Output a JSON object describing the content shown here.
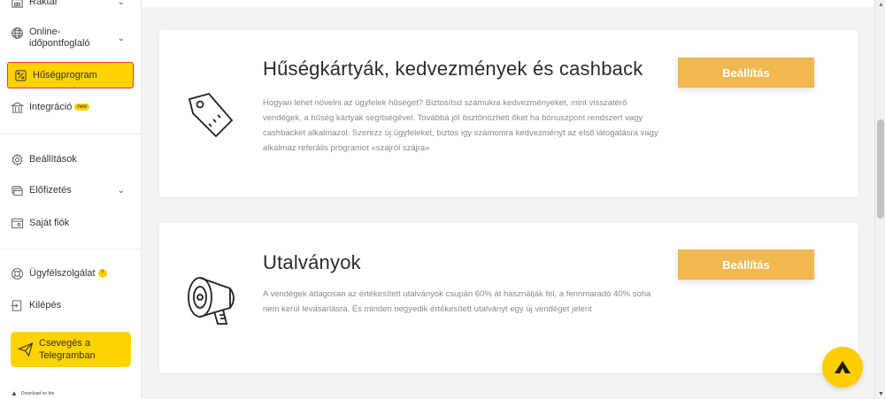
{
  "sidebar": {
    "items": [
      {
        "label": "Raktár",
        "icon": "warehouse-icon"
      },
      {
        "label": "Online-időpontfoglaló",
        "line1": "Online-",
        "line2": "időpontfoglaló",
        "icon": "globe-icon"
      },
      {
        "label": "Hűségprogram",
        "icon": "loyalty-icon"
      },
      {
        "label": "Integráció",
        "badge": "new",
        "icon": "integration-icon"
      },
      {
        "label": "Beállítások",
        "icon": "gear-icon"
      },
      {
        "label": "Előfizetés",
        "icon": "subscription-icon"
      },
      {
        "label": "Saját fiók",
        "icon": "account-icon"
      },
      {
        "label": "Ügyfélszolgálat",
        "badge": "?",
        "icon": "support-icon"
      },
      {
        "label": "Kilépés",
        "icon": "logout-icon"
      }
    ],
    "telegram": {
      "line1": "Csevegés a",
      "line2": "Telegramban"
    },
    "appstore": "Download on the"
  },
  "cards": [
    {
      "title": "Hűségkártyák, kedvezmények és cashback",
      "description": "Hogyan lehet növelni az ügyfelek hűségét? Biztosítsd számukra kedvezményeket, mint visszatérő vendégek, a hűség kártyák segítségével. Továbbá jól ösztönözheti őket ha bónuszpont rendszert vagy cashbacket alkalmazol. Szerezz új ügyfeleket, biztos igy számomra kedvezményt az első látogatásra vagy alkalmaz referális programot «szájról szájra»",
      "button": "Beállítás",
      "icon": "price-tag-icon"
    },
    {
      "title": "Utalványok",
      "description": "A vendégek átlagosan az értékesített utalványok csupán 60% át használják fel, a fennmaradó 40% soha nem kerül levásárlásra. És minden negyedik értékesített utalványt egy új vendéget jelent",
      "button": "Beállítás",
      "icon": "megaphone-icon"
    }
  ],
  "colors": {
    "accent": "#ffd200",
    "button": "#f1b750",
    "active_border": "#e53935"
  }
}
